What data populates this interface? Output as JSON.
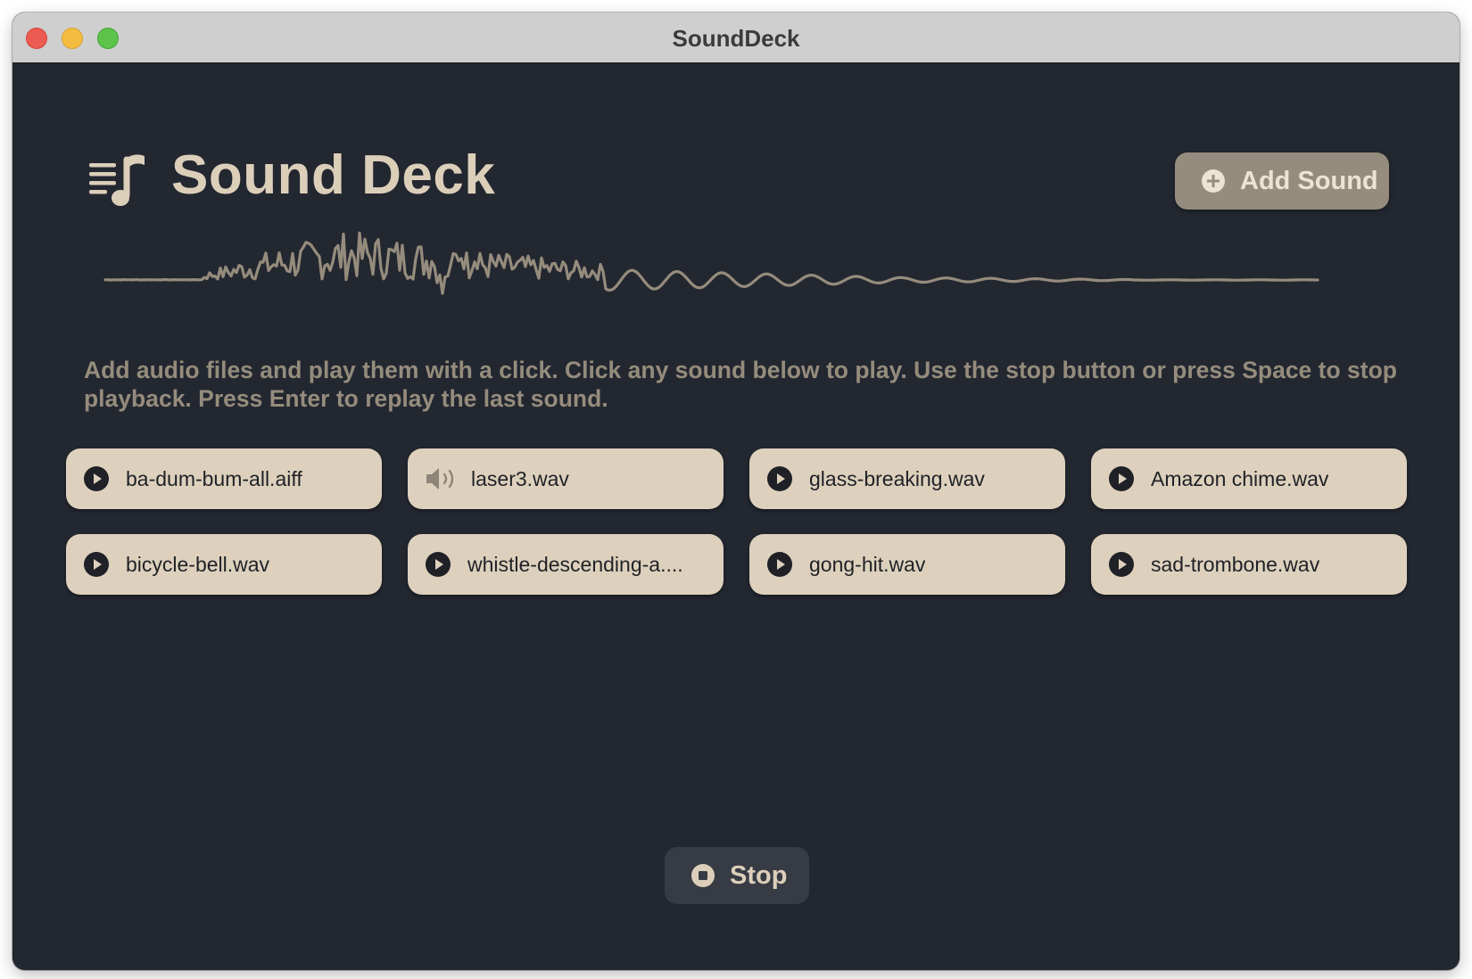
{
  "window": {
    "title": "SoundDeck"
  },
  "header": {
    "title": "Sound Deck",
    "logo_icon": "music-list-icon",
    "add_button": {
      "label": "Add Sound",
      "icon": "plus-circle-icon"
    }
  },
  "instructions": "Add audio files and play them with a click. Click any sound below to play. Use the stop button or press Space to stop playback. Press Enter to replay the last sound.",
  "sounds": [
    {
      "label": "ba-dum-bum-all.aiff",
      "icon": "play-circle-icon",
      "playing": false
    },
    {
      "label": "laser3.wav",
      "icon": "speaker-icon",
      "playing": true
    },
    {
      "label": "glass-breaking.wav",
      "icon": "play-circle-icon",
      "playing": false
    },
    {
      "label": "Amazon chime.wav",
      "icon": "play-circle-icon",
      "playing": false
    },
    {
      "label": "bicycle-bell.wav",
      "icon": "play-circle-icon",
      "playing": false
    },
    {
      "label": "whistle-descending-a....",
      "icon": "play-circle-icon",
      "playing": false
    },
    {
      "label": "gong-hit.wav",
      "icon": "play-circle-icon",
      "playing": false
    },
    {
      "label": "sad-trombone.wav",
      "icon": "play-circle-icon",
      "playing": false
    }
  ],
  "stop_button": {
    "label": "Stop",
    "icon": "stop-circle-icon"
  },
  "colors": {
    "background": "#232730",
    "accent": "#dccfba",
    "muted": "#958c7d",
    "card": "#ddd1bd"
  }
}
